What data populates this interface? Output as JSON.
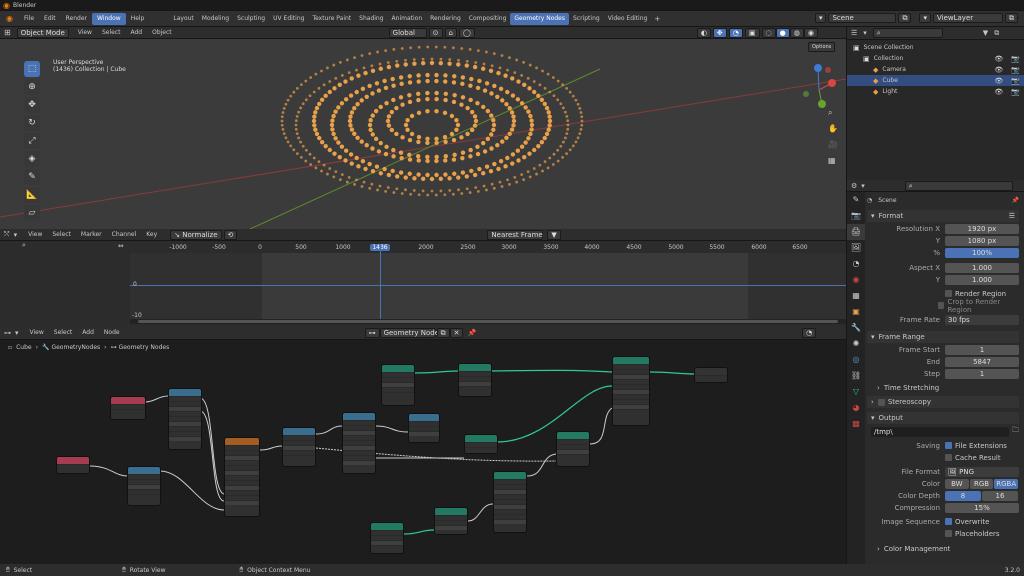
{
  "window": {
    "title": "Blender"
  },
  "menu": [
    "File",
    "Edit",
    "Render",
    "Window",
    "Help"
  ],
  "active_menu": "Window",
  "workspaces": [
    "Layout",
    "Modeling",
    "Sculpting",
    "UV Editing",
    "Texture Paint",
    "Shading",
    "Animation",
    "Rendering",
    "Compositing",
    "Geometry Nodes",
    "Scripting",
    "Video Editing"
  ],
  "active_workspace": "Geometry Nodes",
  "scene": "Scene",
  "view_layer": "ViewLayer",
  "viewport": {
    "mode": "Object Mode",
    "menus": [
      "View",
      "Select",
      "Add",
      "Object"
    ],
    "transform": "Global",
    "options": "Options",
    "info_line1": "User Perspective",
    "info_line2": "(1436) Collection | Cube"
  },
  "timeline": {
    "menus": [
      "View",
      "Select",
      "Marker",
      "Channel",
      "Key"
    ],
    "normalize": "Normalize",
    "frame_mode": "Nearest Frame",
    "ticks": [
      "-1000",
      "-500",
      "0",
      "500",
      "1000",
      "1436",
      "2000",
      "2500",
      "3000",
      "3500",
      "4000",
      "4500",
      "5000",
      "5500",
      "6000",
      "6500"
    ],
    "current_frame": "1436",
    "y0": "0",
    "y10": "-10"
  },
  "node_editor": {
    "menus": [
      "View",
      "Select",
      "Add",
      "Node"
    ],
    "tree_name": "Geometry Nodes",
    "breadcrumb": [
      "Cube",
      "GeometryNodes",
      "Geometry Nodes"
    ]
  },
  "outliner": {
    "items": [
      {
        "label": "Scene Collection",
        "indent": 0
      },
      {
        "label": "Collection",
        "indent": 1
      },
      {
        "label": "Camera",
        "indent": 2
      },
      {
        "label": "Cube",
        "indent": 2
      },
      {
        "label": "Light",
        "indent": 2
      }
    ]
  },
  "properties": {
    "scene_label": "Scene",
    "format": {
      "header": "Format",
      "res_x_label": "Resolution X",
      "res_x": "1920 px",
      "res_y_label": "Y",
      "res_y": "1080 px",
      "pct_label": "%",
      "pct": "100%",
      "aspect_x_label": "Aspect X",
      "aspect_x": "1.000",
      "aspect_y_label": "Y",
      "aspect_y": "1.000",
      "render_region": "Render Region",
      "crop": "Crop to Render Region",
      "frame_rate_label": "Frame Rate",
      "frame_rate": "30 fps"
    },
    "frame_range": {
      "header": "Frame Range",
      "start_label": "Frame Start",
      "start": "1",
      "end_label": "End",
      "end": "5847",
      "step_label": "Step",
      "step": "1",
      "time_stretching": "Time Stretching",
      "stereoscopy": "Stereoscopy"
    },
    "output": {
      "header": "Output",
      "path": "/tmp\\",
      "saving_label": "Saving",
      "file_ext": "File Extensions",
      "cache_result": "Cache Result",
      "file_format_label": "File Format",
      "file_format": "PNG",
      "color_label": "Color",
      "color_opts": [
        "BW",
        "RGB",
        "RGBA"
      ],
      "color_active": "RGBA",
      "depth_label": "Color Depth",
      "depth_opts": [
        "8",
        "16"
      ],
      "compression_label": "Compression",
      "compression": "15%",
      "seq_label": "Image Sequence",
      "overwrite": "Overwrite",
      "placeholders": "Placeholders",
      "color_mgmt": "Color Management"
    }
  },
  "status": {
    "left": "Select",
    "mid": "Rotate View",
    "right": "Object Context Menu",
    "version": "3.2.0"
  },
  "colors": {
    "accent": "#4a72b5",
    "points": "#e8a04a"
  }
}
